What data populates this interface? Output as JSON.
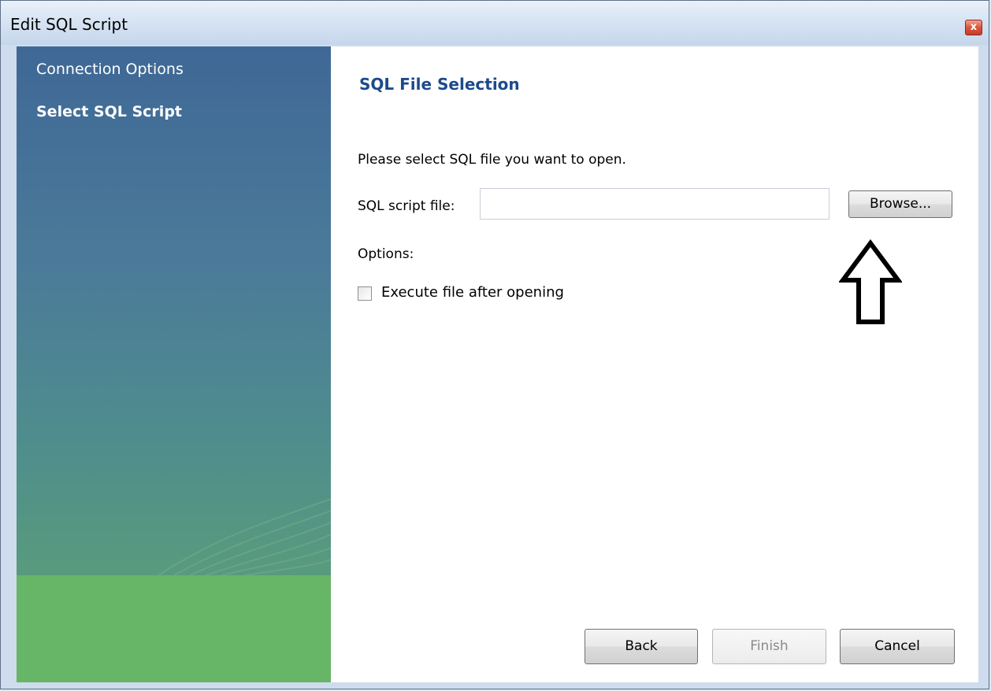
{
  "window": {
    "title": "Edit SQL Script",
    "close_symbol": "x"
  },
  "sidebar": {
    "items": [
      {
        "label": "Connection Options",
        "active": false
      },
      {
        "label": "Select SQL Script",
        "active": true
      }
    ]
  },
  "main": {
    "heading": "SQL File Selection",
    "description": "Please select SQL file you want to open.",
    "file_label": "SQL script file:",
    "file_value": "",
    "browse_label": "Browse...",
    "options_label": "Options:",
    "execute_checkbox_label": "Execute file after opening",
    "execute_checked": false
  },
  "buttons": {
    "back": "Back",
    "finish": "Finish",
    "cancel": "Cancel"
  },
  "annotation": {
    "icon": "up-arrow-icon"
  },
  "colors": {
    "heading": "#1c4a8c",
    "sidebar_top": "#3f6896",
    "sidebar_bottom": "#67b567"
  }
}
